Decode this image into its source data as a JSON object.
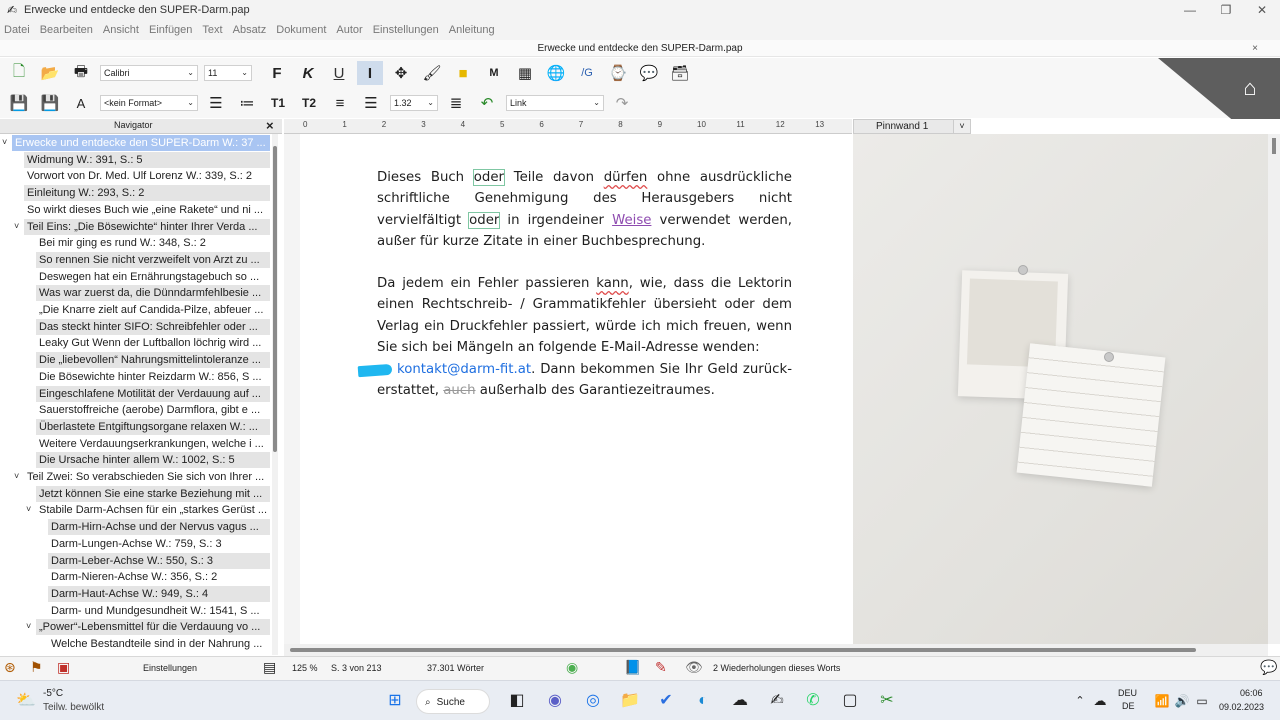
{
  "window": {
    "title": "Erwecke und entdecke den SUPER-Darm.pap",
    "min_icon": "minimize-icon",
    "max_icon": "maximize-icon",
    "close_icon": "close-icon"
  },
  "menu": [
    "Datei",
    "Bearbeiten",
    "Ansicht",
    "Einfügen",
    "Text",
    "Absatz",
    "Dokument",
    "Autor",
    "Einstellungen",
    "Anleitung"
  ],
  "document_tab": {
    "title": "Erwecke und entdecke den SUPER-Darm.pap",
    "close": "×"
  },
  "toolbar1": {
    "font": "Calibri",
    "size": "11",
    "bold": "F",
    "italic": "K",
    "underline": "U",
    "indicator": "I"
  },
  "toolbar2": {
    "style": "<kein Format>",
    "line_spacing": "1.32",
    "link_style": "Link",
    "t1": "T1",
    "t2": "T2"
  },
  "navigator": {
    "title": "Navigator",
    "close": "×",
    "items": [
      {
        "text": "Erwecke und entdecke den SUPER-Darm  W.: 37 ...",
        "indent": 0,
        "toggle": "˅",
        "style": "sel"
      },
      {
        "text": "Widmung  W.: 391, S.: 5",
        "indent": 1,
        "toggle": "",
        "style": "alt"
      },
      {
        "text": "Vorwort von Dr. Med. Ulf Lorenz  W.: 339, S.: 2",
        "indent": 1,
        "toggle": "",
        "style": ""
      },
      {
        "text": "Einleitung  W.: 293, S.: 2",
        "indent": 1,
        "toggle": "",
        "style": "alt"
      },
      {
        "text": "So wirkt dieses Buch wie „eine Rakete“ und ni ...",
        "indent": 1,
        "toggle": "",
        "style": ""
      },
      {
        "text": "Teil Eins: „Die Bösewichte“  hinter Ihrer Verda ...",
        "indent": 1,
        "toggle": "˅",
        "style": "alt"
      },
      {
        "text": "Bei mir ging es rund  W.: 348, S.: 2",
        "indent": 2,
        "toggle": "",
        "style": ""
      },
      {
        "text": "So rennen Sie nicht verzweifelt von Arzt zu  ...",
        "indent": 2,
        "toggle": "",
        "style": "alt"
      },
      {
        "text": "Deswegen hat ein Ernährungstagebuch so  ...",
        "indent": 2,
        "toggle": "",
        "style": ""
      },
      {
        "text": "Was war zuerst da, die Dünndarmfehlbesie ...",
        "indent": 2,
        "toggle": "",
        "style": "alt"
      },
      {
        "text": "„Die Knarre zielt auf Candida-Pilze, abfeuer ...",
        "indent": 2,
        "toggle": "",
        "style": ""
      },
      {
        "text": "Das steckt hinter SIFO: Schreibfehler oder  ...",
        "indent": 2,
        "toggle": "",
        "style": "alt"
      },
      {
        "text": "Leaky Gut Wenn der Luftballon löchrig wird ...",
        "indent": 2,
        "toggle": "",
        "style": ""
      },
      {
        "text": "Die „liebevollen“ Nahrungsmittelintoleranze ...",
        "indent": 2,
        "toggle": "",
        "style": "alt"
      },
      {
        "text": "Die Bösewichte hinter Reizdarm  W.: 856, S ...",
        "indent": 2,
        "toggle": "",
        "style": ""
      },
      {
        "text": "Eingeschlafene Motilität der Verdauung auf ...",
        "indent": 2,
        "toggle": "",
        "style": "alt"
      },
      {
        "text": "Sauerstoffreiche (aerobe) Darmflora, gibt e ...",
        "indent": 2,
        "toggle": "",
        "style": ""
      },
      {
        "text": "Überlastete Entgiftungsorgane relaxen  W.: ...",
        "indent": 2,
        "toggle": "",
        "style": "alt"
      },
      {
        "text": "Weitere Verdauungserkrankungen, welche i ...",
        "indent": 2,
        "toggle": "",
        "style": ""
      },
      {
        "text": "Die Ursache hinter allem  W.: 1002, S.: 5",
        "indent": 2,
        "toggle": "",
        "style": "alt"
      },
      {
        "text": "Teil Zwei: So verabschieden Sie sich von Ihrer ...",
        "indent": 1,
        "toggle": "˅",
        "style": ""
      },
      {
        "text": "Jetzt können Sie eine starke Beziehung mit  ...",
        "indent": 2,
        "toggle": "",
        "style": "alt"
      },
      {
        "text": "Stabile Darm-Achsen für ein „starkes Gerüst ...",
        "indent": 2,
        "toggle": "˅",
        "style": ""
      },
      {
        "text": "Darm-Hirn-Achse und der Nervus vagus   ...",
        "indent": 3,
        "toggle": "",
        "style": "alt"
      },
      {
        "text": "Darm-Lungen-Achse  W.: 759, S.: 3",
        "indent": 3,
        "toggle": "",
        "style": ""
      },
      {
        "text": "Darm-Leber-Achse  W.: 550, S.: 3",
        "indent": 3,
        "toggle": "",
        "style": "alt"
      },
      {
        "text": "Darm-Nieren-Achse  W.: 356, S.: 2",
        "indent": 3,
        "toggle": "",
        "style": ""
      },
      {
        "text": "Darm-Haut-Achse  W.: 949, S.: 4",
        "indent": 3,
        "toggle": "",
        "style": "alt"
      },
      {
        "text": "Darm- und Mundgesundheit  W.: 1541, S ...",
        "indent": 3,
        "toggle": "",
        "style": ""
      },
      {
        "text": "„Power“-Lebensmittel für die Verdauung vo ...",
        "indent": 2,
        "toggle": "˅",
        "style": "alt"
      },
      {
        "text": "Welche Bestandteile sind in der Nahrung  ...",
        "indent": 3,
        "toggle": "",
        "style": ""
      }
    ]
  },
  "ruler": [
    "0",
    "1",
    "2",
    "3",
    "4",
    "5",
    "6",
    "7",
    "8",
    "9",
    "10",
    "11",
    "12",
    "13"
  ],
  "editor": {
    "p1": {
      "a": "Dieses Buch ",
      "oder1": "oder",
      "b": " Teile davon ",
      "duerfen": "dürfen",
      "c": " ohne ausdrückliche schrift­liche Genehmigung des Herausgebers nicht vervielfältigt ",
      "oder2": "oder",
      "d": " in irgendeiner ",
      "weise": "Weise",
      "e": " verwendet werden, außer für kurze Zitate in einer Buchbesprechung."
    },
    "p2": {
      "a": "Da jedem ein Fehler passieren ",
      "kann": "kann",
      "b": ", wie, dass die Lektorin einen Rechtschreib- / Grammatikfehler übersieht oder dem Verlag ein Druckfehler passiert, würde ich mich freuen, wenn Sie sich bei Mängeln an folgende E-Mail-Adresse wenden:"
    },
    "p3": {
      "email": "kontakt@darm-fit.at",
      "a": ". Dann bekommen Sie Ihr Geld zurück­erstattet, ",
      "auch": "auch",
      "b": " außerhalb des Garantiezeitraumes."
    }
  },
  "pinboard": {
    "label": "Pinnwand 1",
    "arrow": "˅"
  },
  "statusbar": {
    "settings": "Einstellungen",
    "zoom": "125 %",
    "page": "S. 3 von 213",
    "words": "37.301 Wörter",
    "repeat": "2 Wiederholungen dieses Worts"
  },
  "taskbar": {
    "temp": "-5°C",
    "weather": "Teilw. bewölkt",
    "search": "Suche",
    "lang1": "DEU",
    "lang2": "DE",
    "time": "06:06",
    "date": "09.02.2023"
  }
}
